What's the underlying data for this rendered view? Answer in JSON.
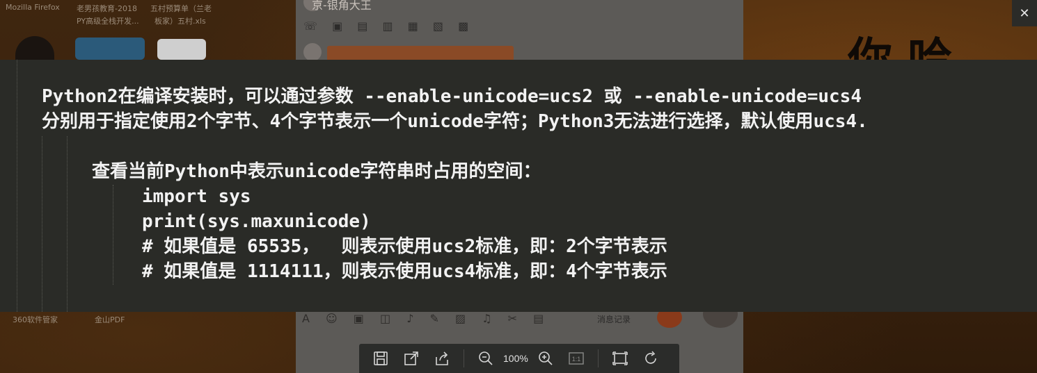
{
  "desktop": {
    "top_labels": [
      "Mozilla Firefox",
      "老男孩教育-2018",
      "PY高级全栈开发...",
      "五村预算单（兰老",
      "板家）五村.xls"
    ],
    "bottom_labels": [
      "360软件管家",
      "金山PDF"
    ],
    "chat_title": "京-银角大王",
    "chat_history": "消息记录"
  },
  "close": {
    "glyph": "✕"
  },
  "image": {
    "line1": "Python2在编译安装时，可以通过参数 --enable-unicode=ucs2 或 --enable-unicode=ucs4",
    "line2": "分别用于指定使用2个字节、4个字节表示一个unicode字符；Python3无法进行选择，默认使用ucs4.",
    "line3": "查看当前Python中表示unicode字符串时占用的空间：",
    "code1": "import sys",
    "code2": "print(sys.maxunicode)",
    "code3": "# 如果值是 65535，  则表示使用ucs2标准，即：2个字节表示",
    "code4": "# 如果值是 1114111，则表示使用ucs4标准，即：4个字节表示"
  },
  "toolbar": {
    "zoom": "100%",
    "icons": [
      "save-icon",
      "open-external-icon",
      "share-icon",
      "zoom-out-icon",
      "zoom-in-icon",
      "actual-size-icon",
      "fit-window-icon",
      "rotate-icon"
    ],
    "actual_size_label": "1:1"
  },
  "colors": {
    "panel_bg": "#2a2b27",
    "text": "#f2f2f2",
    "toolbar_bg": "#2b2c2a"
  }
}
